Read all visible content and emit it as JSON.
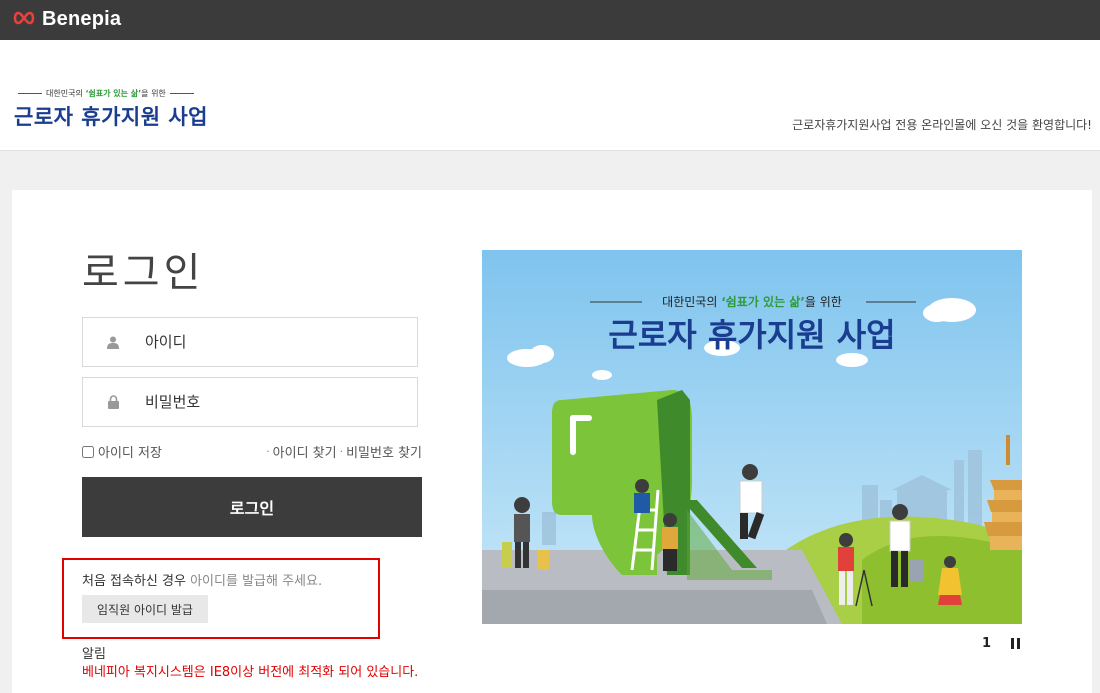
{
  "topbar": {
    "brand": "Benepia",
    "brand_icon": "infinity-logo-icon"
  },
  "header": {
    "logo_pre": "대한민국의",
    "logo_quote": "‘쉼표가 있는 삶’",
    "logo_post": "을 위한",
    "logo_main": "근로자 휴가지원 사업",
    "welcome": "근로자휴가지원사업 전용 온라인몰에 오신 것을 환영합니다!"
  },
  "login": {
    "title": "로그인",
    "id_placeholder": "아이디",
    "pw_placeholder": "비밀번호",
    "save_id": "아이디 저장",
    "find_id": "아이디 찾기",
    "find_pw": "비밀번호 찾기",
    "submit": "로그인"
  },
  "notice": {
    "text_dark": "처음 접속하신 경우",
    "text_light": "아이디를 발급해 주세요.",
    "issue_button": "임직원 아이디 발급"
  },
  "alert": {
    "heading": "알림",
    "message": "베네피아 복지시스템은 IE8이상 버전에 최적화 되어 있습니다."
  },
  "banner": {
    "pre": "대한민국의",
    "quote": "‘쉼표가 있는 삶’",
    "post": "을 위한",
    "title": "근로자 휴가지원 사업"
  },
  "pager": {
    "current": "1"
  },
  "colors": {
    "topbar": "#3b3b3b",
    "logo_blue": "#1a3d8f",
    "accent_green": "#2e9b3b",
    "alert_red": "#e00000",
    "button_dark": "#3c3c3c"
  }
}
